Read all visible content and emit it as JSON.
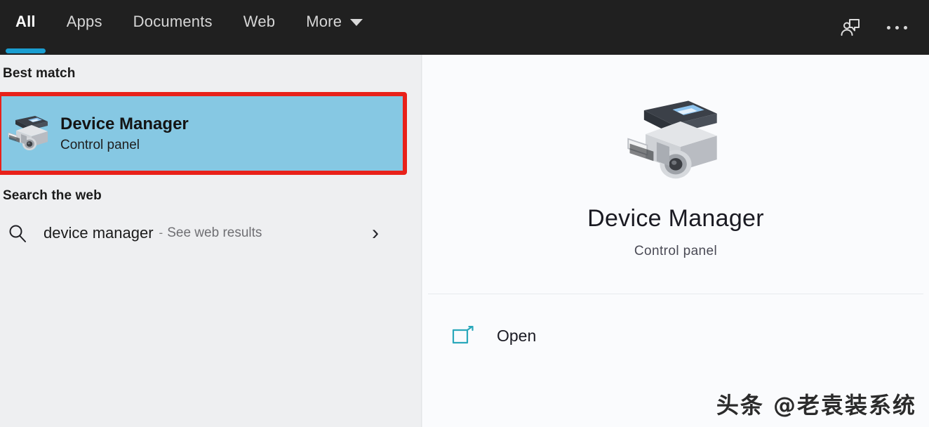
{
  "topbar": {
    "tabs": [
      {
        "label": "All",
        "active": true
      },
      {
        "label": "Apps",
        "active": false
      },
      {
        "label": "Documents",
        "active": false
      },
      {
        "label": "Web",
        "active": false
      },
      {
        "label": "More",
        "active": false
      }
    ],
    "more_caret_icon": "chevron-down-icon",
    "feedback_icon": "feedback-person-icon",
    "overflow_icon": "ellipsis-icon",
    "accent_color": "#1a9ed1",
    "background_color": "#202020"
  },
  "left_pane": {
    "best_match_header": "Best match",
    "best_match_result": {
      "title": "Device Manager",
      "subtitle": "Control panel",
      "icon": "device-manager-icon",
      "selected": true,
      "highlight_color": "#86c8e3",
      "annotation_border_color": "#e8211a"
    },
    "search_web_header": "Search the web",
    "web_result": {
      "query": "device manager",
      "separator": "-",
      "suffix": "See web results",
      "search_icon": "search-icon",
      "chevron_icon": "chevron-right-icon"
    }
  },
  "right_pane": {
    "preview": {
      "icon": "device-manager-icon",
      "title": "Device Manager",
      "subtitle": "Control panel"
    },
    "actions": [
      {
        "label": "Open",
        "icon": "open-window-icon",
        "icon_color": "#2aa8bb"
      }
    ]
  },
  "watermark": {
    "text": "头条 @老袁装系统"
  }
}
